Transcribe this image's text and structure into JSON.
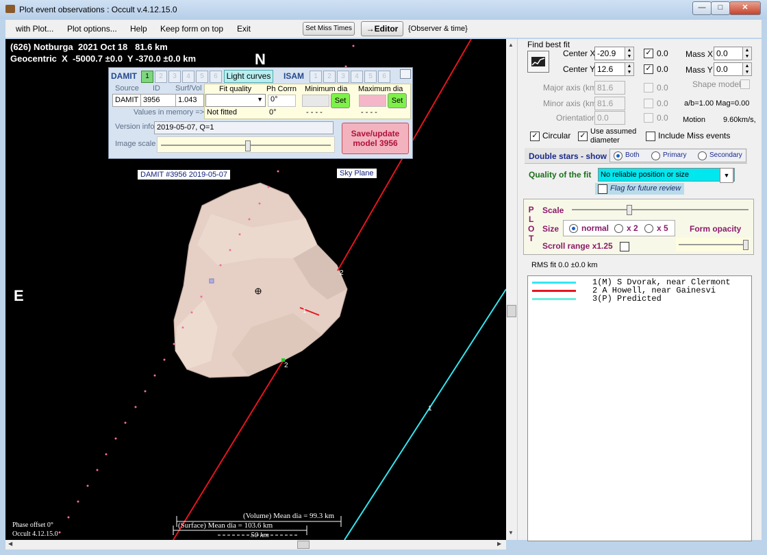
{
  "window": {
    "title": "Plot event observations : Occult v.4.12.15.0"
  },
  "menu": {
    "with_plot": "with Plot...",
    "plot_options": "Plot options...",
    "help": "Help",
    "keep_on_top": "Keep form on top",
    "exit": "Exit",
    "set_miss_times": "Set Miss Times",
    "editor": "→Editor",
    "observer_time": "{Observer & time}"
  },
  "plot": {
    "header_line1": "(626) Notburga  2021 Oct 18   81.6 km",
    "header_line2": "Geocentric  X  -5000.7 ±0.0  Y -370.0 ±0.0 km",
    "north": "N",
    "east": "E",
    "damit_label": "DAMIT #3956 2019-05-07",
    "sky_plane": "Sky Plane",
    "chord_labels": {
      "a": "2",
      "b": "1",
      "c": "2",
      "d": "1"
    },
    "volume_dia": "(Volume) Mean dia = 99.3 km",
    "surface_dia": "(Surface) Mean dia = 103.6 km",
    "scale_label": "50 km",
    "phase_offset": "Phase offset 0°",
    "version": "Occult 4.12.15.0"
  },
  "damit": {
    "damit_title": "DAMIT",
    "damit_nums": [
      "1",
      "2",
      "3",
      "4",
      "5",
      "6"
    ],
    "light_curves": "Light curves",
    "isam_title": "ISAM",
    "isam_nums": [
      "1",
      "2",
      "3",
      "4",
      "5",
      "6"
    ],
    "source_lbl": "Source",
    "id_lbl": "ID",
    "surfvol_lbl": "Surf/Vol",
    "source_val": "DAMIT",
    "id_val": "3956",
    "surfvol_val": "1.043",
    "fit_quality_lbl": "Fit quality",
    "ph_corr_lbl": "Ph Corrn",
    "min_dia_lbl": "Minimum dia",
    "max_dia_lbl": "Maximum dia",
    "ph_corr_val": "0°",
    "set": "Set",
    "values_in_memory": "Values in memory =>",
    "not_fitted": "Not fitted",
    "ph_mem": "0°",
    "dashes": "- - - -",
    "version_info_lbl": "Version info",
    "version_info_val": "2019-05-07, Q=1",
    "image_scale_lbl": "Image scale",
    "save_update": "Save/update",
    "model": "model 3956"
  },
  "right": {
    "find_best_fit": "Find best fit",
    "center_x_lbl": "Center X",
    "center_x_val": "-20.9",
    "center_y_lbl": "Center Y",
    "center_y_val": "12.6",
    "zero": "0.0",
    "mass_x_lbl": "Mass X",
    "mass_x_val": "0.0",
    "mass_y_lbl": "Mass Y",
    "mass_y_val": "0.0",
    "major_lbl": "Major axis (km)",
    "major_val": "81.6",
    "minor_lbl": "Minor axis (km)",
    "minor_val": "81.6",
    "orient_lbl": "Orientation",
    "orient_val": "0.0",
    "shape_model": "Shape model",
    "ab_ratio": "a/b=1.00  Mag=0.00",
    "motion_lbl": "Motion",
    "motion_val": "9.60km/s, ",
    "circular": "Circular",
    "use_assumed": "Use assumed",
    "diameter": "diameter",
    "include_miss": "Include Miss events",
    "double_stars": "Double stars - show",
    "both": "Both",
    "primary": "Primary",
    "secondary": "Secondary",
    "quality_lbl": "Quality of the fit",
    "quality_val": "No reliable position or size",
    "flag_review": "Flag for future review",
    "plot_letters": [
      "P",
      "L",
      "O",
      "T"
    ],
    "scale_lbl": "Scale",
    "size_lbl": "Size",
    "normal": "normal",
    "x2": "x 2",
    "x5": "x 5",
    "form_opacity": "Form opacity",
    "scroll_range": "Scroll range x1.25",
    "rms_fit": "RMS fit 0.0 ±0.0 km"
  },
  "legend": [
    {
      "color": "#33e6f0",
      "text": "1(M)  S Dvorak, near Clermont"
    },
    {
      "color": "#e6141e",
      "text": "2     A Howell, near Gainesvi"
    },
    {
      "color": "#66f0dc",
      "text": "3(P)  Predicted"
    }
  ]
}
